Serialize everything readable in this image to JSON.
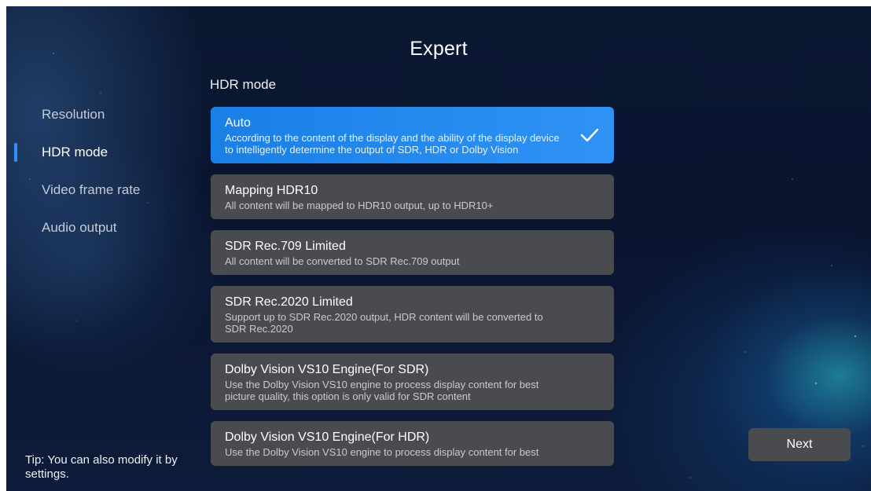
{
  "header": {
    "title": "Expert"
  },
  "section": {
    "label": "HDR mode"
  },
  "sidebar": {
    "items": [
      {
        "label": "Resolution",
        "active": false
      },
      {
        "label": "HDR mode",
        "active": true
      },
      {
        "label": "Video frame rate",
        "active": false
      },
      {
        "label": "Audio output",
        "active": false
      }
    ]
  },
  "options": [
    {
      "title": "Auto",
      "desc": "According to the content of the display and the ability of the display device to intelligently determine the output of SDR, HDR or Dolby Vision",
      "selected": true,
      "icon": "check-icon"
    },
    {
      "title": "Mapping HDR10",
      "desc": "All content will be mapped to HDR10 output, up to HDR10+",
      "selected": false
    },
    {
      "title": "SDR Rec.709 Limited",
      "desc": "All content will be converted to SDR Rec.709 output",
      "selected": false
    },
    {
      "title": "SDR Rec.2020 Limited",
      "desc": "Support up to SDR Rec.2020 output, HDR content will be converted to SDR Rec.2020",
      "selected": false
    },
    {
      "title": "Dolby Vision VS10 Engine(For SDR)",
      "desc": "Use the Dolby Vision VS10 engine to process display content for best picture quality, this option is only valid for SDR content",
      "selected": false
    },
    {
      "title": "Dolby Vision VS10 Engine(For HDR)",
      "desc": "Use the Dolby Vision VS10 engine to process display content for best",
      "selected": false
    }
  ],
  "tip": {
    "text": "Tip: You can also modify it by settings."
  },
  "footer": {
    "next_label": "Next"
  },
  "colors": {
    "accent": "#2f8fff",
    "selected_option": "#1f86ec",
    "option_bg": "#4a4b4e",
    "background": "#0b1832"
  }
}
